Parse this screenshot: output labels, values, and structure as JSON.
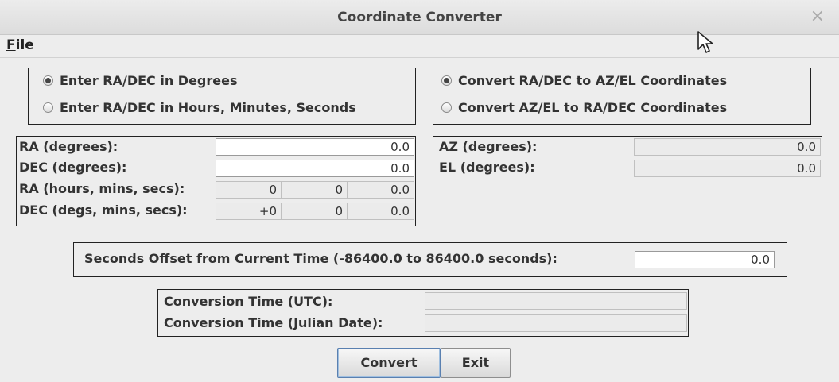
{
  "window": {
    "title": "Coordinate Converter",
    "close_glyph": "×"
  },
  "menu": {
    "file_mnemonic": "F",
    "file_rest": "ile"
  },
  "input_mode": {
    "options": [
      "Enter RA/DEC in Degrees",
      "Enter RA/DEC in Hours, Minutes, Seconds"
    ],
    "selected": 0
  },
  "conversion_mode": {
    "options": [
      "Convert RA/DEC to AZ/EL Coordinates",
      "Convert AZ/EL to RA/DEC Coordinates"
    ],
    "selected": 0
  },
  "radec": {
    "ra_deg_label": "RA (degrees):",
    "ra_deg_value": "0.0",
    "dec_deg_label": "DEC (degrees):",
    "dec_deg_value": "0.0",
    "ra_hms_label": "RA (hours, mins, secs):",
    "ra_hms": [
      "0",
      "0",
      "0.0"
    ],
    "dec_dms_label": "DEC (degs, mins, secs):",
    "dec_dms": [
      "+0",
      "0",
      "0.0"
    ]
  },
  "azel": {
    "az_label": "AZ (degrees):",
    "az_value": "0.0",
    "el_label": "EL (degrees):",
    "el_value": "0.0"
  },
  "offset": {
    "label": "Seconds Offset from Current Time  (-86400.0 to 86400.0 seconds):",
    "value": "0.0"
  },
  "conversion_time": {
    "utc_label": "Conversion Time (UTC):",
    "utc_value": "",
    "jd_label": "Conversion Time (Julian Date):",
    "jd_value": ""
  },
  "buttons": {
    "convert": "Convert",
    "exit": "Exit"
  },
  "icons": {
    "close": "close-icon",
    "cursor": "mouse-pointer-icon"
  }
}
